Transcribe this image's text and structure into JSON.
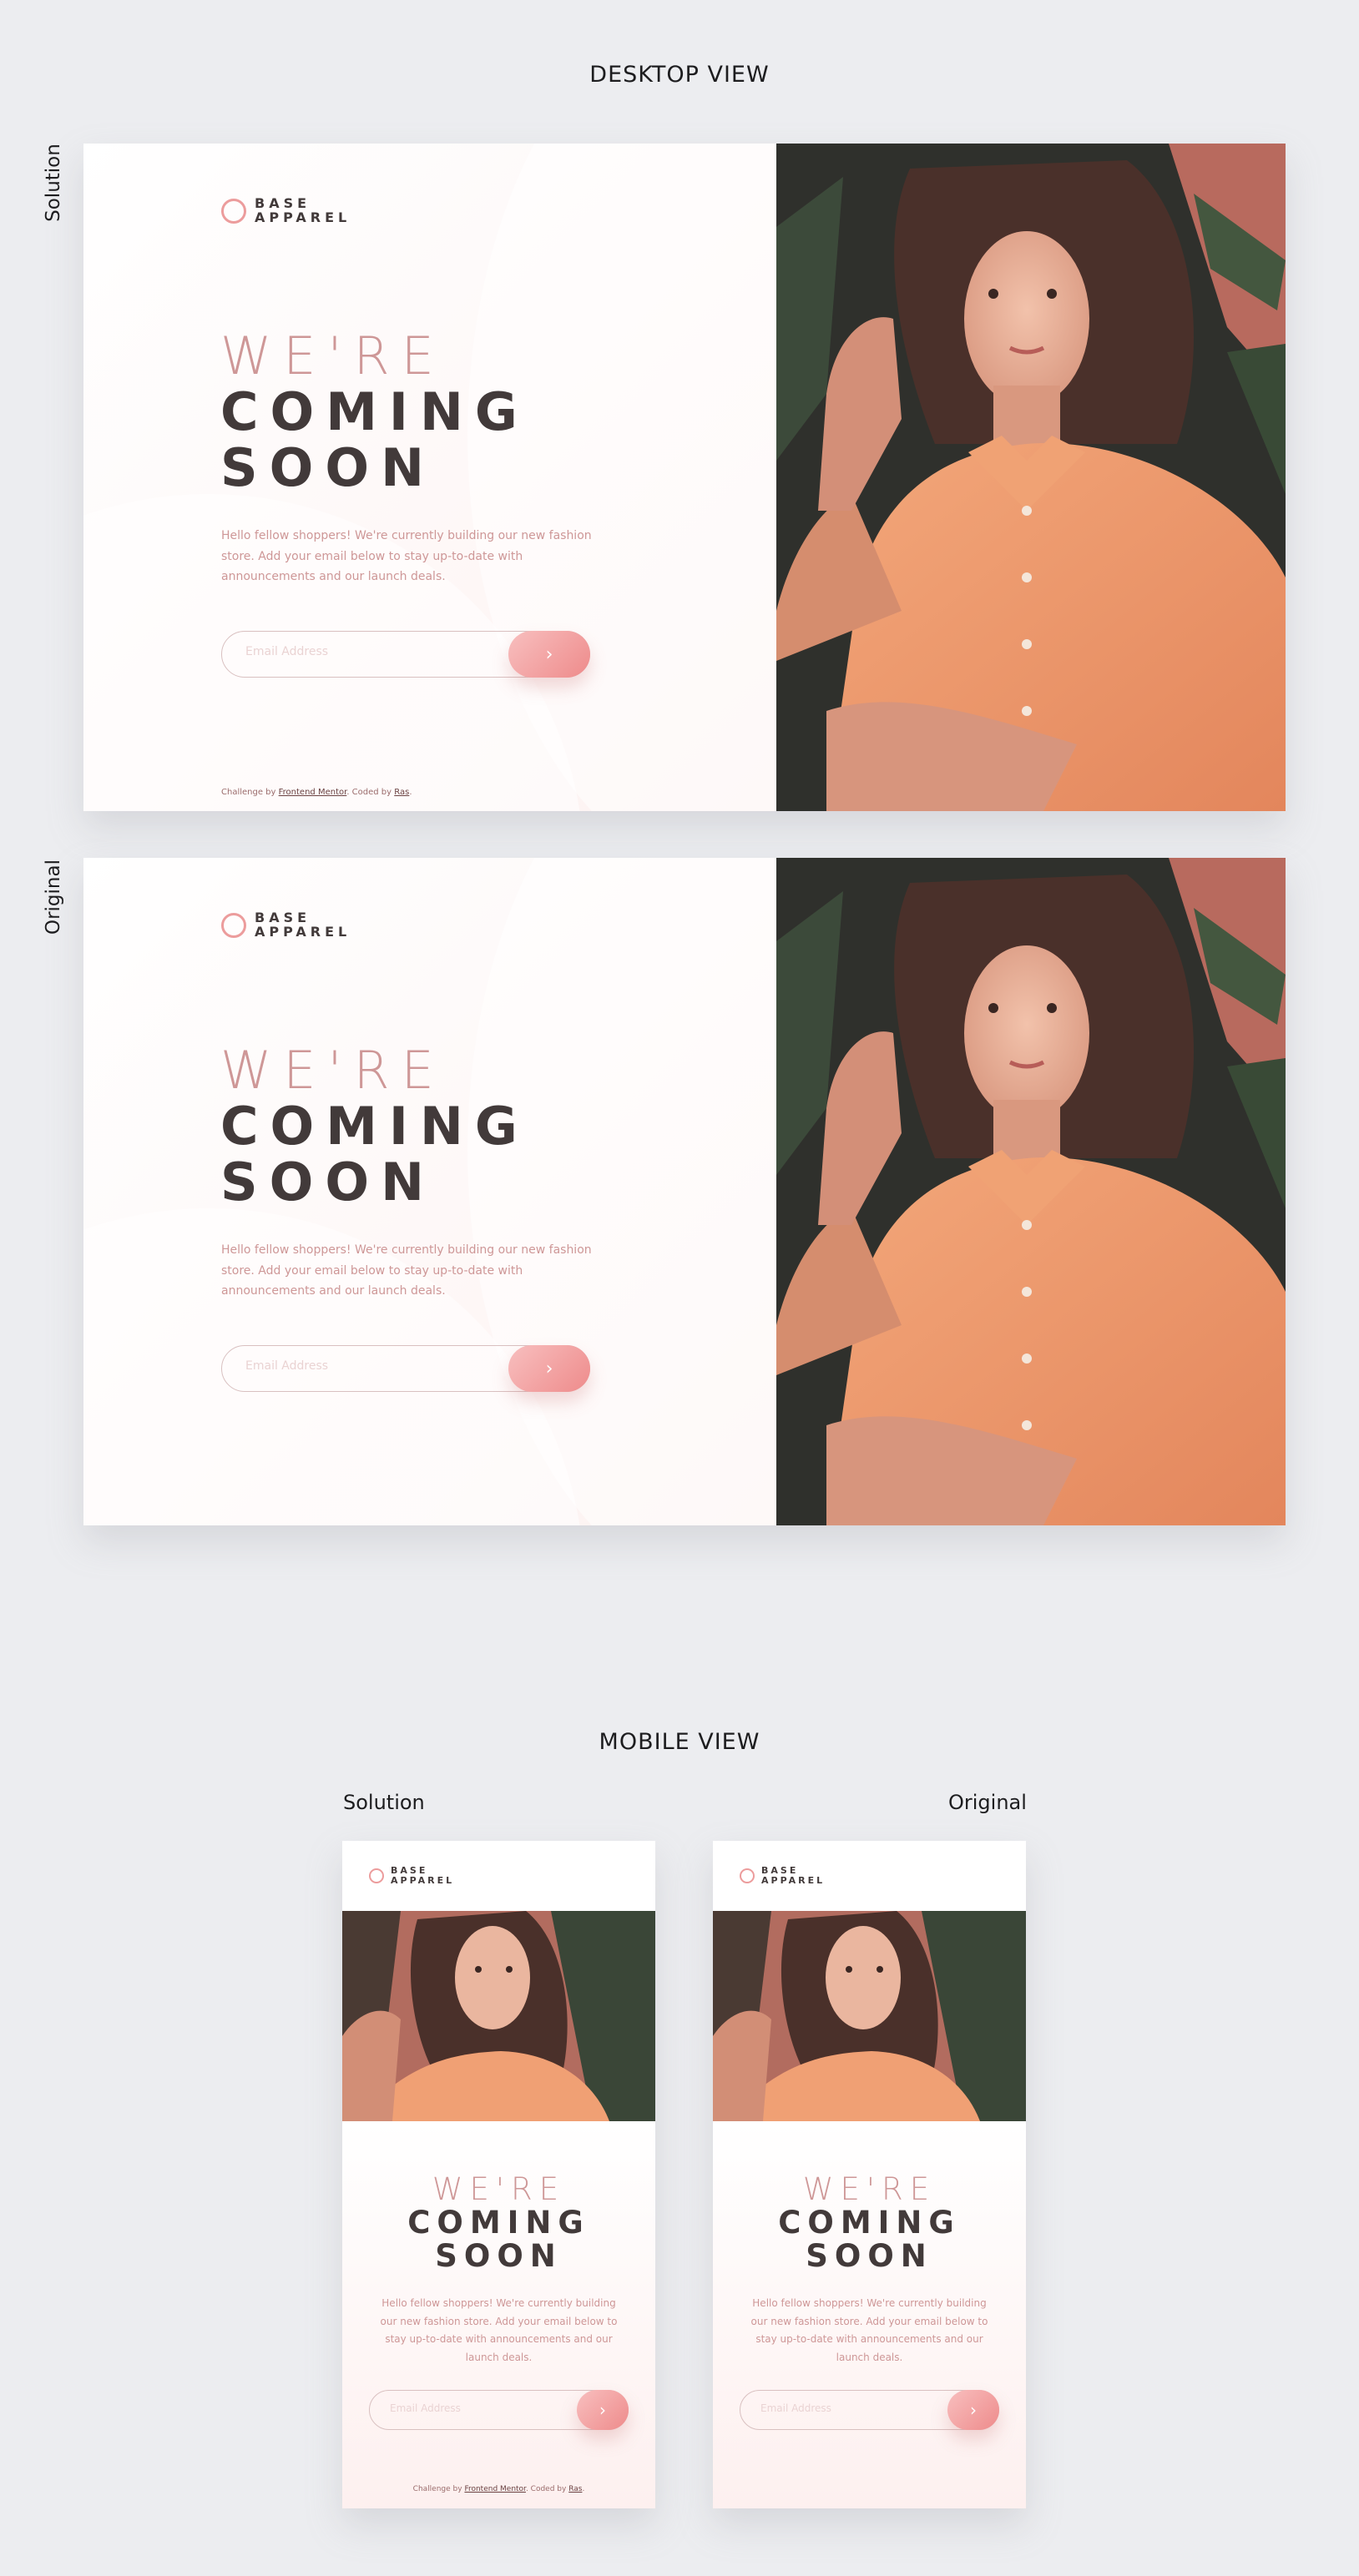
{
  "sections": {
    "desktop_title": "DESKTOP VIEW",
    "mobile_title": "MOBILE VIEW"
  },
  "labels": {
    "solution": "Solution",
    "original": "Original"
  },
  "site": {
    "logo_line1": "BASE",
    "logo_line2": "APPAREL",
    "headline_light": "WE'RE",
    "headline_dark1": "COMING",
    "headline_dark2": "SOON",
    "copy_desktop": "Hello fellow shoppers! We're currently building our new fashion store. Add your email below to stay up-to-date with announcements and our launch deals.",
    "copy_mobile": "Hello fellow shoppers! We're currently building our new fashion store. Add your email below to stay up-to-date with announcements and our launch deals.",
    "email_placeholder": "Email Address",
    "submit_icon": "chevron-right-icon",
    "attribution_prefix": "Challenge by",
    "attribution_link1": "Frontend Mentor",
    "attribution_mid": ". Coded by",
    "attribution_link2": "Ras",
    "attribution_end": "."
  },
  "colors": {
    "accent": "#ce9797",
    "dark": "#423a3a",
    "button_start": "#f8bfbf",
    "button_end": "#ee8b8b",
    "page_bg": "#ecedf0"
  }
}
